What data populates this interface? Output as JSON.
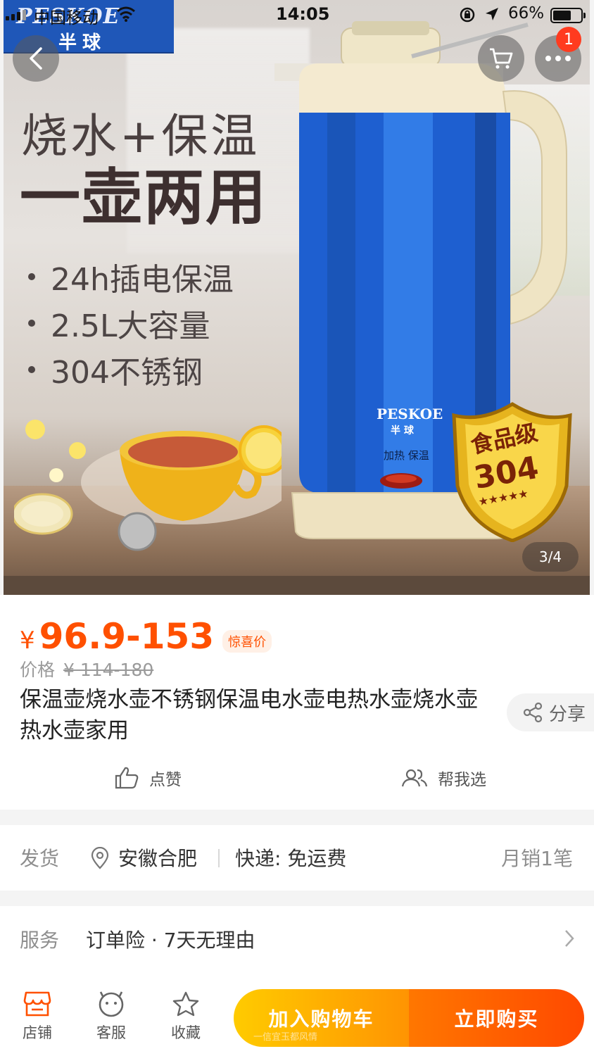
{
  "status_bar": {
    "carrier": "中国移动",
    "time": "14:05",
    "battery": "66%",
    "battery_level": 0.66
  },
  "hero": {
    "brand_en": "PESKOE",
    "brand_cn": "半球",
    "headline_1": "烧水+保温",
    "headline_2": "一壶两用",
    "features": [
      "24h插电保温",
      "2.5L大容量",
      "304不锈钢"
    ],
    "kettle_brand_en": "PESKOE",
    "kettle_brand_cn": "半球",
    "kettle_label": "加热 保温",
    "shield_line1": "食品级",
    "shield_line2": "304",
    "pager": "3/4",
    "cart_badge": "1"
  },
  "product": {
    "currency": "¥",
    "price": "96.9-153",
    "price_tag": "惊喜价",
    "orig_label": "价格",
    "orig_price": "¥ 114-180",
    "title": "保温壶烧水壶不锈钢保温电水壶电热水壶烧水壶热水壶家用",
    "share": "分享",
    "like": "点赞",
    "help_choose": "帮我选"
  },
  "shipping": {
    "label": "发货",
    "location": "安徽合肥",
    "express": "快递: 免运费",
    "sales": "月销1笔"
  },
  "service": {
    "label": "服务",
    "value": "订单险 · 7天无理由"
  },
  "bottom_bar": {
    "store": "店铺",
    "customer_service": "客服",
    "favorite": "收藏",
    "add_to_cart": "加入购物车",
    "buy_now": "立即购买"
  },
  "watermark": "一信宜玉都风情",
  "colors": {
    "accent": "#ff5000",
    "cart_gradient": [
      "#ffcb00",
      "#ff9402"
    ],
    "buy_gradient": [
      "#ff7700",
      "#ff4900"
    ]
  }
}
